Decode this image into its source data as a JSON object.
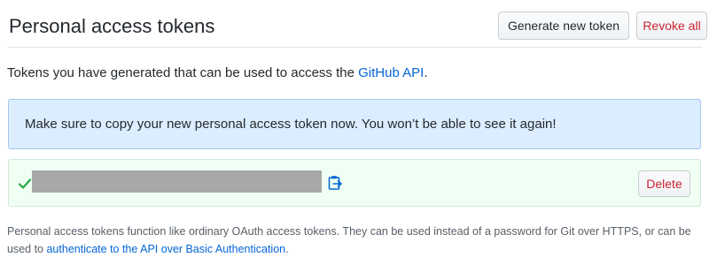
{
  "header": {
    "title": "Personal access tokens",
    "generate_label": "Generate new token",
    "revoke_label": "Revoke all"
  },
  "intro": {
    "text": "Tokens you have generated that can be used to access the ",
    "link_text": "GitHub API",
    "suffix": "."
  },
  "flash": {
    "message": "Make sure to copy your new personal access token now. You won’t be able to see it again!"
  },
  "token": {
    "delete_label": "Delete"
  },
  "footnote": {
    "text": "Personal access tokens function like ordinary OAuth access tokens. They can be used instead of a password for Git over HTTPS, or can be used to ",
    "link_text": "authenticate to the API over Basic Authentication",
    "suffix": "."
  },
  "colors": {
    "link": "#0366d6",
    "danger": "#cb2431",
    "success": "#28a745",
    "flash_bg": "#dbedff",
    "token_bg": "#f0fff4"
  },
  "icons": [
    "check-icon",
    "clipboard-icon"
  ]
}
